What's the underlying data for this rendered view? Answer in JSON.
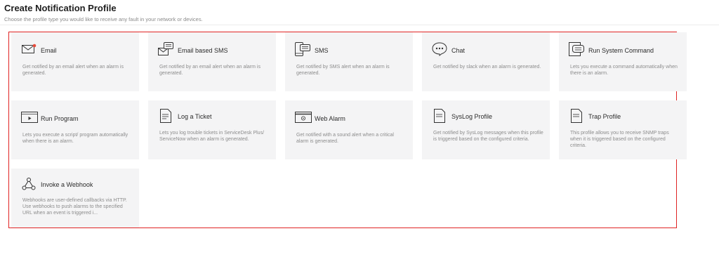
{
  "header": {
    "title": "Create Notification Profile",
    "subtitle": "Choose the profile type you would like to receive any fault in your network or devices."
  },
  "profiles": [
    {
      "name": "Email",
      "icon": "email-icon",
      "description": "Get notified by an email alert when an alarm is generated."
    },
    {
      "name": "Email based SMS",
      "icon": "email-sms-icon",
      "description": "Get notified by an email alert when an alarm is generated."
    },
    {
      "name": "SMS",
      "icon": "sms-icon",
      "description": "Get notified by SMS alert when an alarm is generated."
    },
    {
      "name": "Chat",
      "icon": "chat-icon",
      "description": "Get notified by slack when an alarm is generated."
    },
    {
      "name": "Run System Command",
      "icon": "system-command-icon",
      "description": "Lets you execute a command automatically when there is an alarm."
    },
    {
      "name": "Run Program",
      "icon": "run-program-icon",
      "description": "Lets you execute a script/ program automatically when there is an alarm."
    },
    {
      "name": "Log a Ticket",
      "icon": "ticket-icon",
      "description": "Lets you log trouble tickets in ServiceDesk Plus/ ServiceNow when an alarm is generated."
    },
    {
      "name": "Web Alarm",
      "icon": "web-alarm-icon",
      "description": "Get notified with a sound alert when a critical alarm is generated."
    },
    {
      "name": "SysLog Profile",
      "icon": "syslog-icon",
      "description": "Get notified by SysLog messages when this profile is triggered based on the configured criteria."
    },
    {
      "name": "Trap Profile",
      "icon": "trap-icon",
      "description": "This profile allows you to receive SNMP traps when it is triggered based on the configured criteria."
    },
    {
      "name": "Invoke a Webhook",
      "icon": "webhook-icon",
      "description": "Webhooks are user-defined callbacks via HTTP. Use webhooks to push alarms to the specified URL when an event is triggered i..."
    }
  ],
  "colors": {
    "highlight_border": "#e02424",
    "card_background": "#f4f4f5",
    "email_badge": "#e74c3c"
  }
}
